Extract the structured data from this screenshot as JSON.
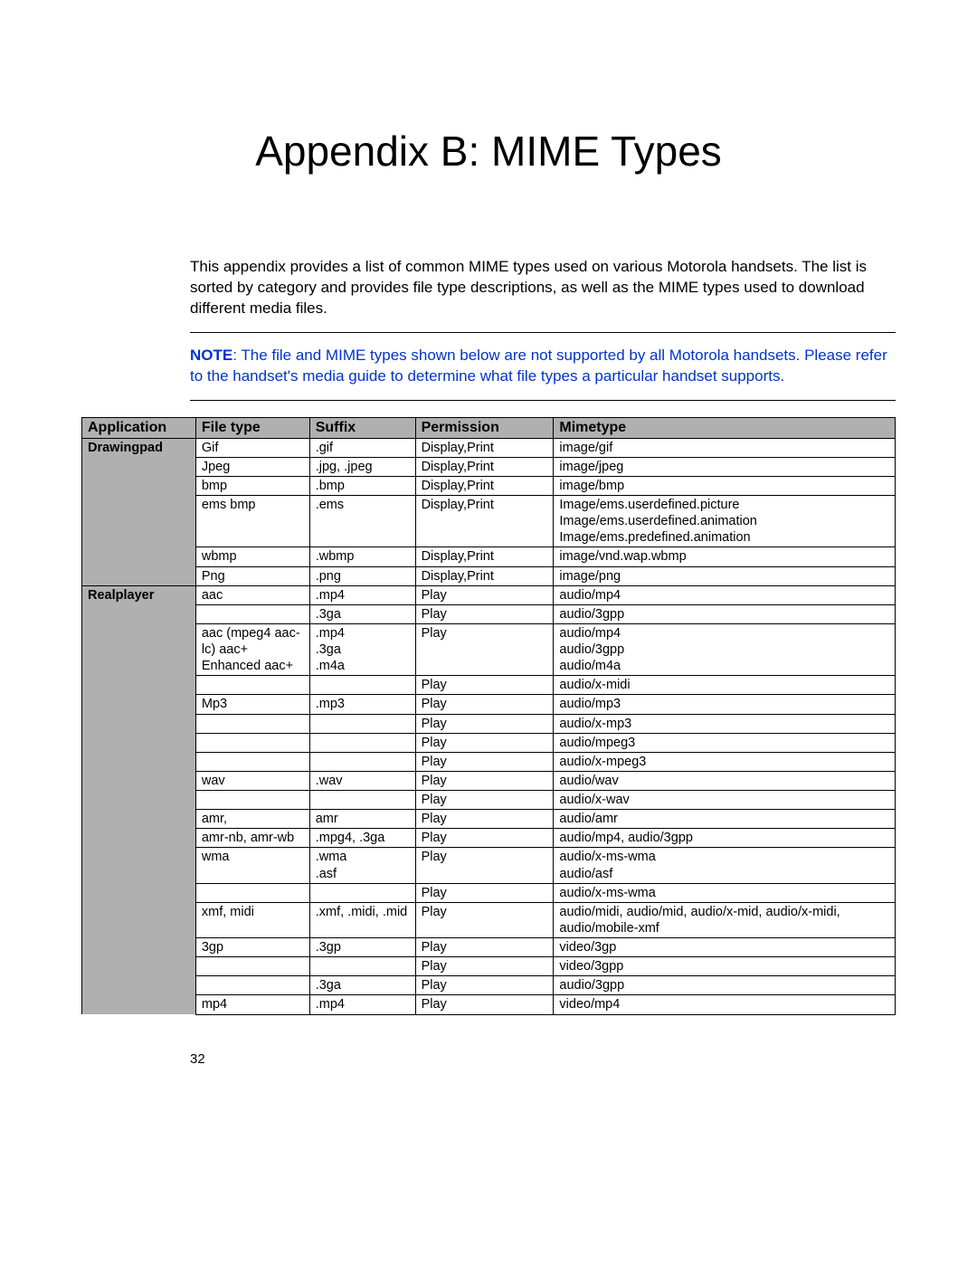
{
  "title": "Appendix B: MIME Types",
  "intro": "This appendix provides a list of common MIME types used on various Motorola handsets. The list is sorted by category and provides file type descriptions, as well as the MIME types used to download different media files.",
  "note_label": "NOTE",
  "note_body": ": The file and MIME types shown below are not supported by all Motorola handsets. Please refer to the handset's media guide to determine what file types a particular handset supports.",
  "headers": {
    "application": "Application",
    "filetype": "File type",
    "suffix": "Suffix",
    "permission": "Permission",
    "mimetype": "Mimetype"
  },
  "rows": [
    {
      "app": "Drawingpad",
      "filetype": "Gif",
      "suffix": ".gif",
      "permission": "Display,Print",
      "mimetype": "image/gif"
    },
    {
      "app": "",
      "filetype": "Jpeg",
      "suffix": ".jpg, .jpeg",
      "permission": "Display,Print",
      "mimetype": "image/jpeg"
    },
    {
      "app": "",
      "filetype": "bmp",
      "suffix": ".bmp",
      "permission": "Display,Print",
      "mimetype": "image/bmp"
    },
    {
      "app": "",
      "filetype": "ems bmp",
      "suffix": ".ems",
      "permission": "Display,Print",
      "mimetype": "Image/ems.userdefined.picture\nImage/ems.userdefined.animation\nImage/ems.predefined.animation"
    },
    {
      "app": "",
      "filetype": "wbmp",
      "suffix": ".wbmp",
      "permission": "Display,Print",
      "mimetype": "image/vnd.wap.wbmp"
    },
    {
      "app": "",
      "filetype": "Png",
      "suffix": ".png",
      "permission": "Display,Print",
      "mimetype": "image/png"
    },
    {
      "app": "Realplayer",
      "filetype": "aac",
      "suffix": ".mp4",
      "permission": "Play",
      "mimetype": "audio/mp4"
    },
    {
      "app": "",
      "filetype": "",
      "suffix": ".3ga",
      "permission": "Play",
      "mimetype": "audio/3gpp"
    },
    {
      "app": "",
      "filetype": "aac (mpeg4 aac-lc) aac+ Enhanced aac+",
      "suffix": ".mp4\n.3ga\n.m4a",
      "permission": "Play",
      "mimetype": "audio/mp4\naudio/3gpp\naudio/m4a"
    },
    {
      "app": "",
      "filetype": "",
      "suffix": "",
      "permission": "Play",
      "mimetype": "audio/x-midi"
    },
    {
      "app": "",
      "filetype": "Mp3",
      "suffix": ".mp3",
      "permission": "Play",
      "mimetype": "audio/mp3"
    },
    {
      "app": "",
      "filetype": "",
      "suffix": "",
      "permission": "Play",
      "mimetype": "audio/x-mp3"
    },
    {
      "app": "",
      "filetype": "",
      "suffix": "",
      "permission": "Play",
      "mimetype": "audio/mpeg3"
    },
    {
      "app": "",
      "filetype": "",
      "suffix": "",
      "permission": "Play",
      "mimetype": "audio/x-mpeg3"
    },
    {
      "app": "",
      "filetype": "wav",
      "suffix": ".wav",
      "permission": "Play",
      "mimetype": "audio/wav"
    },
    {
      "app": "",
      "filetype": "",
      "suffix": "",
      "permission": "Play",
      "mimetype": "audio/x-wav"
    },
    {
      "app": "",
      "filetype": "amr,",
      "suffix": "amr",
      "permission": "Play",
      "mimetype": "audio/amr"
    },
    {
      "app": "",
      "filetype": "amr-nb, amr-wb",
      "suffix": ".mpg4, .3ga",
      "permission": "Play",
      "mimetype": "audio/mp4, audio/3gpp"
    },
    {
      "app": "",
      "filetype": "wma",
      "suffix": ".wma\n.asf",
      "permission": "Play",
      "mimetype": "audio/x-ms-wma\naudio/asf"
    },
    {
      "app": "",
      "filetype": "",
      "suffix": "",
      "permission": "Play",
      "mimetype": "audio/x-ms-wma"
    },
    {
      "app": "",
      "filetype": "xmf, midi",
      "suffix": ".xmf, .midi, .mid",
      "permission": "Play",
      "mimetype": "audio/midi, audio/mid, audio/x-mid, audio/x-midi, audio/mobile-xmf"
    },
    {
      "app": "",
      "filetype": "3gp",
      "suffix": ".3gp",
      "permission": "Play",
      "mimetype": "video/3gp"
    },
    {
      "app": "",
      "filetype": "",
      "suffix": "",
      "permission": "Play",
      "mimetype": "video/3gpp"
    },
    {
      "app": "",
      "filetype": "",
      "suffix": ".3ga",
      "permission": "Play",
      "mimetype": "audio/3gpp"
    },
    {
      "app": "",
      "filetype": "mp4",
      "suffix": ".mp4",
      "permission": "Play",
      "mimetype": "video/mp4"
    }
  ],
  "page_number": "32"
}
